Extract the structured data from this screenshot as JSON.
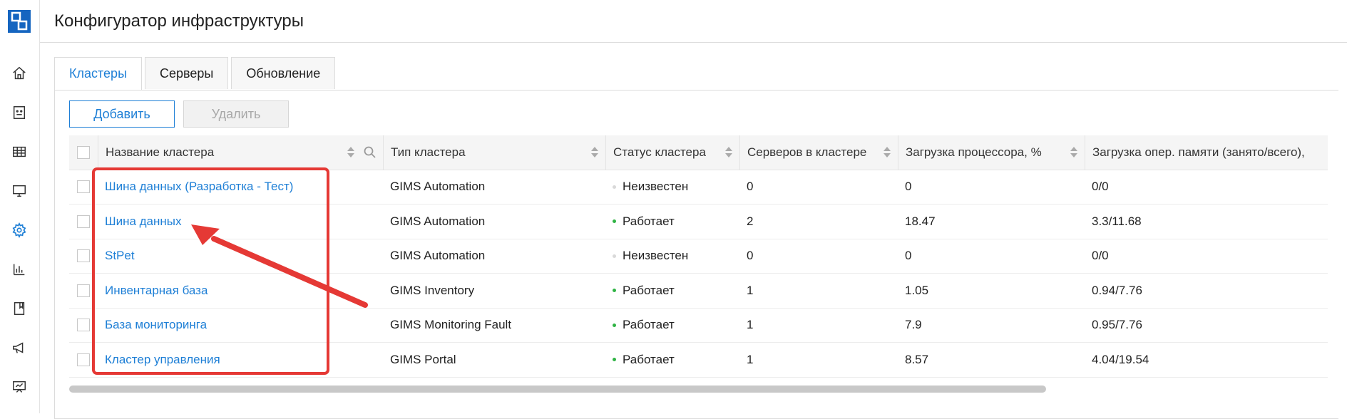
{
  "app": {
    "title": "Конфигуратор инфраструктуры"
  },
  "sidebar": {
    "items": [
      {
        "name": "home-icon"
      },
      {
        "name": "dashboard-icon"
      },
      {
        "name": "table-icon"
      },
      {
        "name": "monitor-icon"
      },
      {
        "name": "gear-icon",
        "active": true
      },
      {
        "name": "bar-chart-icon"
      },
      {
        "name": "book-icon"
      },
      {
        "name": "megaphone-icon"
      },
      {
        "name": "presentation-icon"
      }
    ]
  },
  "tabs": [
    {
      "label": "Кластеры",
      "active": true
    },
    {
      "label": "Серверы",
      "active": false
    },
    {
      "label": "Обновление",
      "active": false
    }
  ],
  "toolbar": {
    "add_label": "Добавить",
    "delete_label": "Удалить"
  },
  "table": {
    "columns": [
      "Название кластера",
      "Тип кластера",
      "Статус кластера",
      "Серверов в кластере",
      "Загрузка процессора, %",
      "Загрузка опер. памяти (занято/всего),"
    ],
    "rows": [
      {
        "name": "Шина данных (Разработка - Тест)",
        "type": "GIMS Automation",
        "status": "Неизвестен",
        "status_color": "#d9d9d9",
        "servers": "0",
        "cpu": "0",
        "mem": "0/0"
      },
      {
        "name": "Шина данных",
        "type": "GIMS Automation",
        "status": "Работает",
        "status_color": "#2fb344",
        "servers": "2",
        "cpu": "18.47",
        "mem": "3.3/11.68"
      },
      {
        "name": "StPet",
        "type": "GIMS Automation",
        "status": "Неизвестен",
        "status_color": "#d9d9d9",
        "servers": "0",
        "cpu": "0",
        "mem": "0/0"
      },
      {
        "name": "Инвентарная база",
        "type": "GIMS Inventory",
        "status": "Работает",
        "status_color": "#2fb344",
        "servers": "1",
        "cpu": "1.05",
        "mem": "0.94/7.76"
      },
      {
        "name": "База мониторинга",
        "type": "GIMS Monitoring Fault",
        "status": "Работает",
        "status_color": "#2fb344",
        "servers": "1",
        "cpu": "7.9",
        "mem": "0.95/7.76"
      },
      {
        "name": "Кластер управления",
        "type": "GIMS Portal",
        "status": "Работает",
        "status_color": "#2fb344",
        "servers": "1",
        "cpu": "8.57",
        "mem": "4.04/19.54"
      }
    ]
  },
  "colors": {
    "accent": "#1e7fd6",
    "annotation": "#e53935"
  }
}
